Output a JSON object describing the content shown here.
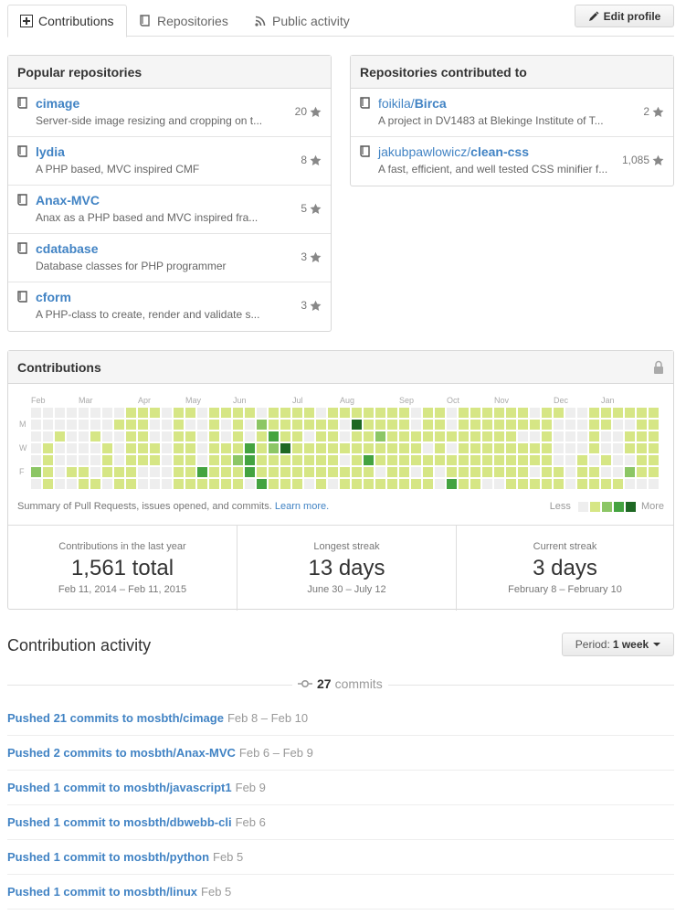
{
  "tabs": {
    "contributions": "Contributions",
    "repositories": "Repositories",
    "public_activity": "Public activity"
  },
  "edit_profile": "Edit profile",
  "popular": {
    "title": "Popular repositories",
    "repos": [
      {
        "name": "cimage",
        "desc": "Server-side image resizing and cropping on t...",
        "stars": "20"
      },
      {
        "name": "lydia",
        "desc": "A PHP based, MVC inspired CMF",
        "stars": "8"
      },
      {
        "name": "Anax-MVC",
        "desc": "Anax as a PHP based and MVC inspired fra...",
        "stars": "5"
      },
      {
        "name": "cdatabase",
        "desc": "Database classes for PHP programmer",
        "stars": "3"
      },
      {
        "name": "cform",
        "desc": "A PHP-class to create, render and validate s...",
        "stars": "3"
      }
    ]
  },
  "contributed": {
    "title": "Repositories contributed to",
    "repos": [
      {
        "owner": "foikila/",
        "name": "Birca",
        "desc": "A project in DV1483 at Blekinge Institute of T...",
        "stars": "2"
      },
      {
        "owner": "jakubpawlowicz/",
        "name": "clean-css",
        "desc": "A fast, efficient, and well tested CSS minifier f...",
        "stars": "1,085"
      }
    ]
  },
  "calendar": {
    "title": "Contributions",
    "months": [
      "Feb",
      "Mar",
      "Apr",
      "May",
      "Jun",
      "Jul",
      "Aug",
      "Sep",
      "Oct",
      "Nov",
      "Dec",
      "Jan"
    ],
    "days": [
      "M",
      "W",
      "F"
    ],
    "colors": [
      "#eeeeee",
      "#d6e685",
      "#8cc665",
      "#44a340",
      "#1e6823"
    ],
    "weeks": [
      "0000020",
      "0001111",
      "0010000",
      "0000010",
      "0000011",
      "0010001",
      "0001110",
      "0100011",
      "1111111",
      "1111100",
      "1001100",
      "0000000",
      "1111111",
      "1011111",
      "0000031",
      "1111111",
      "1001111",
      "1111211",
      "1003330",
      "0211113",
      "1132111",
      "1114111",
      "1111111",
      "1101110",
      "0111111",
      "1111110",
      "1001011",
      "1411111",
      "1111311",
      "1121101",
      "1111111",
      "1111111",
      "0011101",
      "1110111",
      "1111100",
      "0010113",
      "1111111",
      "1111111",
      "1111110",
      "1111110",
      "1111111",
      "1101111",
      "0101101",
      "1111111",
      "1000011",
      "0000000",
      "0000111",
      "1111011",
      "1100101",
      "1000001",
      "1011020",
      "1111110",
      "1111110"
    ],
    "summary_text": "Summary of Pull Requests, issues opened, and commits.",
    "learn_more": "Learn more.",
    "legend_less": "Less",
    "legend_more": "More"
  },
  "stats": [
    {
      "label": "Contributions in the last year",
      "value": "1,561 total",
      "range": "Feb 11, 2014 – Feb 11, 2015"
    },
    {
      "label": "Longest streak",
      "value": "13 days",
      "range": "June 30 – July 12"
    },
    {
      "label": "Current streak",
      "value": "3 days",
      "range": "February 8 – February 10"
    }
  ],
  "activity": {
    "title": "Contribution activity",
    "period_label": "Period:",
    "period_value": "1 week",
    "commit_count": "27",
    "commit_word": "commits",
    "items": [
      {
        "text": "Pushed 21 commits to mosbth/cimage",
        "date": "Feb 8 – Feb 10"
      },
      {
        "text": "Pushed 2 commits to mosbth/Anax-MVC",
        "date": "Feb 6 – Feb 9"
      },
      {
        "text": "Pushed 1 commit to mosbth/javascript1",
        "date": "Feb 9"
      },
      {
        "text": "Pushed 1 commit to mosbth/dbwebb-cli",
        "date": "Feb 6"
      },
      {
        "text": "Pushed 1 commit to mosbth/python",
        "date": "Feb 5"
      },
      {
        "text": "Pushed 1 commit to mosbth/linux",
        "date": "Feb 5"
      }
    ]
  }
}
